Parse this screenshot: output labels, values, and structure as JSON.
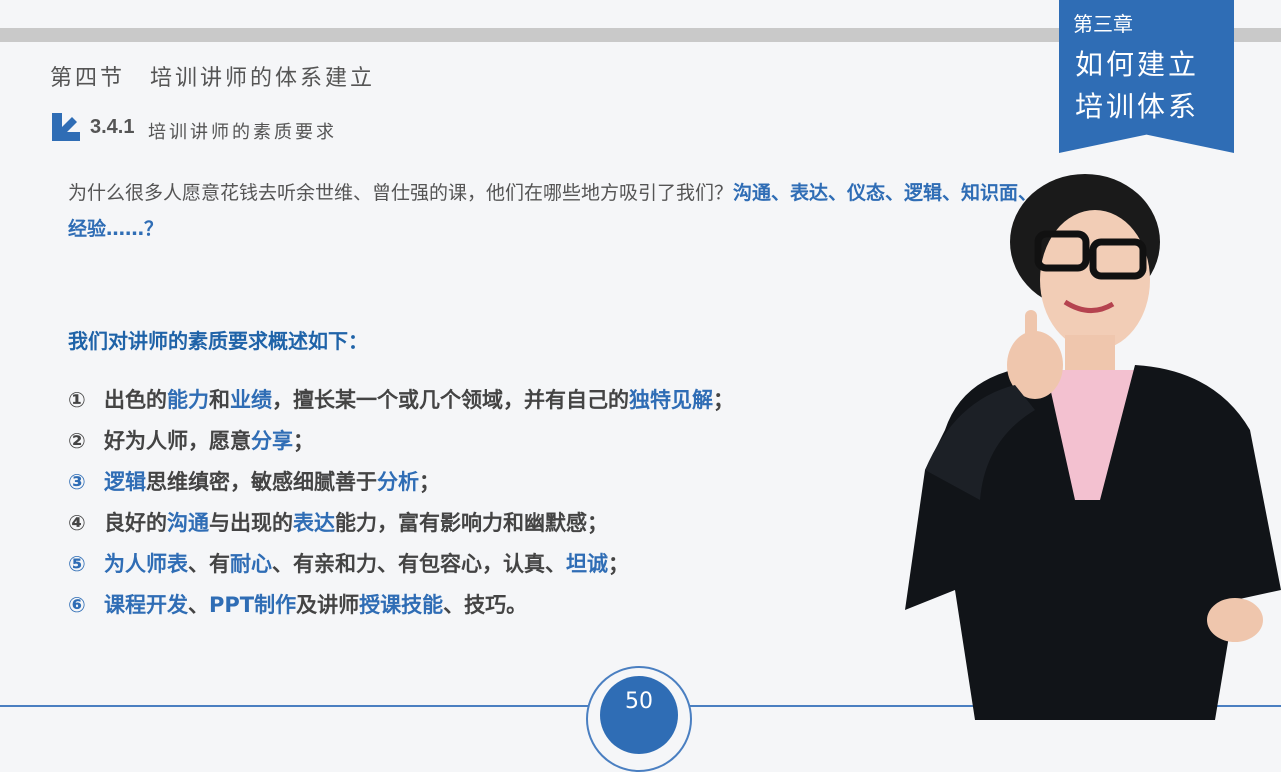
{
  "chapter": {
    "label": "第三章",
    "title": "如何建立培训体系"
  },
  "section_title": "第四节　培训讲师的体系建立",
  "subsection": {
    "number": "3.4.1",
    "title": "培训讲师的素质要求"
  },
  "intro": {
    "part1": "为什么很多人愿意花钱去听余世维、曾仕强的课，他们在哪些地方吸引了我们？",
    "highlight": "沟通、表达、仪态、逻辑、知识面、经验……？"
  },
  "summary": "我们对讲师的素质要求概述如下：",
  "items": [
    {
      "num": "①",
      "segs": [
        [
          "出色的",
          0
        ],
        [
          "能力",
          1
        ],
        [
          "和",
          0
        ],
        [
          "业绩",
          1
        ],
        [
          "，擅长某一个或几个领域，并有自己的",
          0
        ],
        [
          "独特见解",
          1
        ],
        [
          "；",
          0
        ]
      ]
    },
    {
      "num": "②",
      "segs": [
        [
          "好为人师，愿意",
          0
        ],
        [
          "分享",
          1
        ],
        [
          "；",
          0
        ]
      ]
    },
    {
      "num": "③",
      "segs": [
        [
          "逻辑",
          1
        ],
        [
          "思维缜密，敏感细腻善于",
          0
        ],
        [
          "分析",
          1
        ],
        [
          "；",
          0
        ]
      ]
    },
    {
      "num": "④",
      "segs": [
        [
          "良好的",
          0
        ],
        [
          "沟通",
          1
        ],
        [
          "与出现的",
          0
        ],
        [
          "表达",
          1
        ],
        [
          "能力，富有影响力和幽默感；",
          0
        ]
      ]
    },
    {
      "num": "⑤",
      "segs": [
        [
          "为人师表",
          1
        ],
        [
          "、有",
          0
        ],
        [
          "耐心",
          1
        ],
        [
          "、有亲和力、有包容心，认真、",
          0
        ],
        [
          "坦诚",
          1
        ],
        [
          "；",
          0
        ]
      ]
    },
    {
      "num": "⑥",
      "segs": [
        [
          "课程开发",
          1
        ],
        [
          "、",
          0
        ],
        [
          "PPT制作",
          1
        ],
        [
          "及讲师",
          0
        ],
        [
          "授课技能",
          1
        ],
        [
          "、技巧。",
          0
        ]
      ]
    }
  ],
  "page_number": "50",
  "colors": {
    "accent": "#2f6db5",
    "text": "#444444"
  },
  "icons": {
    "subsection": "arrow-down-right-icon",
    "person": "businesswoman-photo"
  }
}
